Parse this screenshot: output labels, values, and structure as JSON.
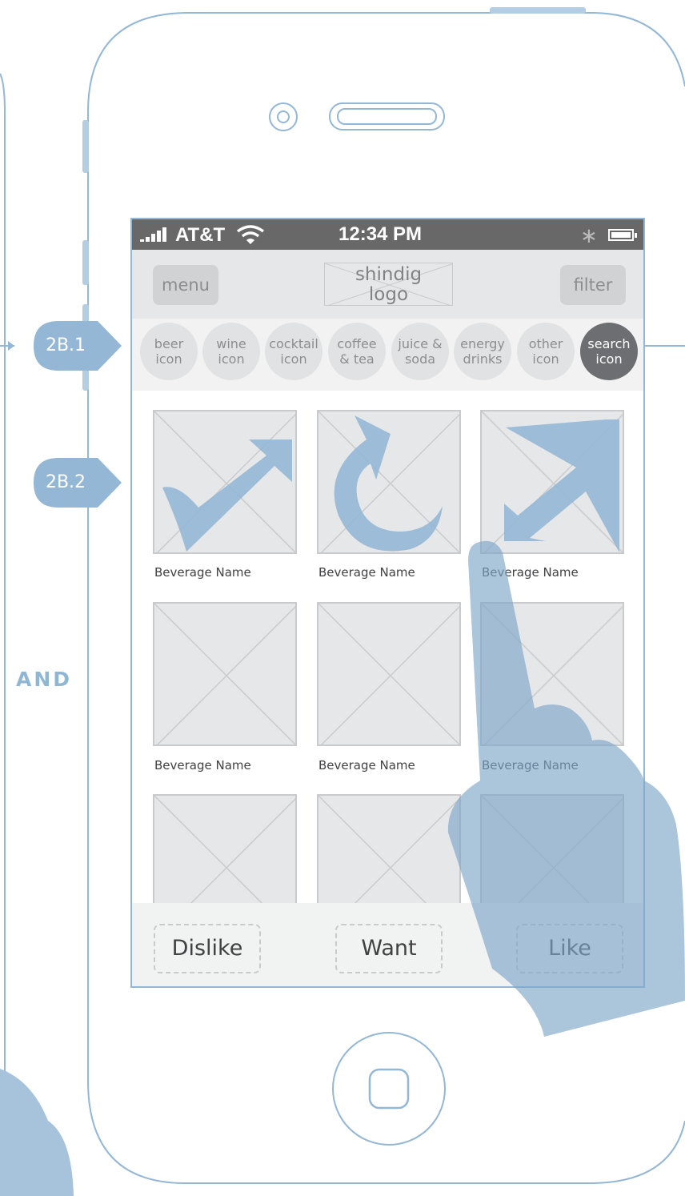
{
  "colors": {
    "outline": "#93b7d5",
    "callout": "#93b7d5",
    "statusbar": "#686868",
    "navbar": "#e6e7e8",
    "placeholder": "#e6e7e8",
    "active_category": "#6d6e71",
    "hand_overlay": "#7ea6c8"
  },
  "annotations": {
    "callout_1": "2B.1",
    "callout_2": "2B.2",
    "and_label": "AND"
  },
  "statusbar": {
    "carrier": "AT&T",
    "time": "12:34 PM",
    "icons": [
      "signal-bars-icon",
      "wifi-icon",
      "bluetooth-icon",
      "battery-icon"
    ]
  },
  "navbar": {
    "menu_label": "menu",
    "logo_text": "shindig\nlogo",
    "filter_label": "filter"
  },
  "categories": [
    {
      "label": "beer\nicon",
      "active": false
    },
    {
      "label": "wine\nicon",
      "active": false
    },
    {
      "label": "cocktail\nicon",
      "active": false
    },
    {
      "label": "coffee\n& tea",
      "active": false
    },
    {
      "label": "juice &\nsoda",
      "active": false
    },
    {
      "label": "energy\ndrinks",
      "active": false
    },
    {
      "label": "other\nicon",
      "active": false
    },
    {
      "label": "search\nicon",
      "active": true
    }
  ],
  "beverages": [
    {
      "name": "Beverage Name",
      "gesture": "swipe-right-up-arrow-icon"
    },
    {
      "name": "Beverage Name",
      "gesture": "rotate-arrow-icon"
    },
    {
      "name": "Beverage Name",
      "gesture": "swipe-left-down-arrow-icon"
    },
    {
      "name": "Beverage Name"
    },
    {
      "name": "Beverage Name"
    },
    {
      "name": "Beverage Name"
    },
    {
      "name": ""
    },
    {
      "name": ""
    },
    {
      "name": ""
    }
  ],
  "actions": {
    "dislike": "Dislike",
    "want": "Want",
    "like": "Like"
  }
}
